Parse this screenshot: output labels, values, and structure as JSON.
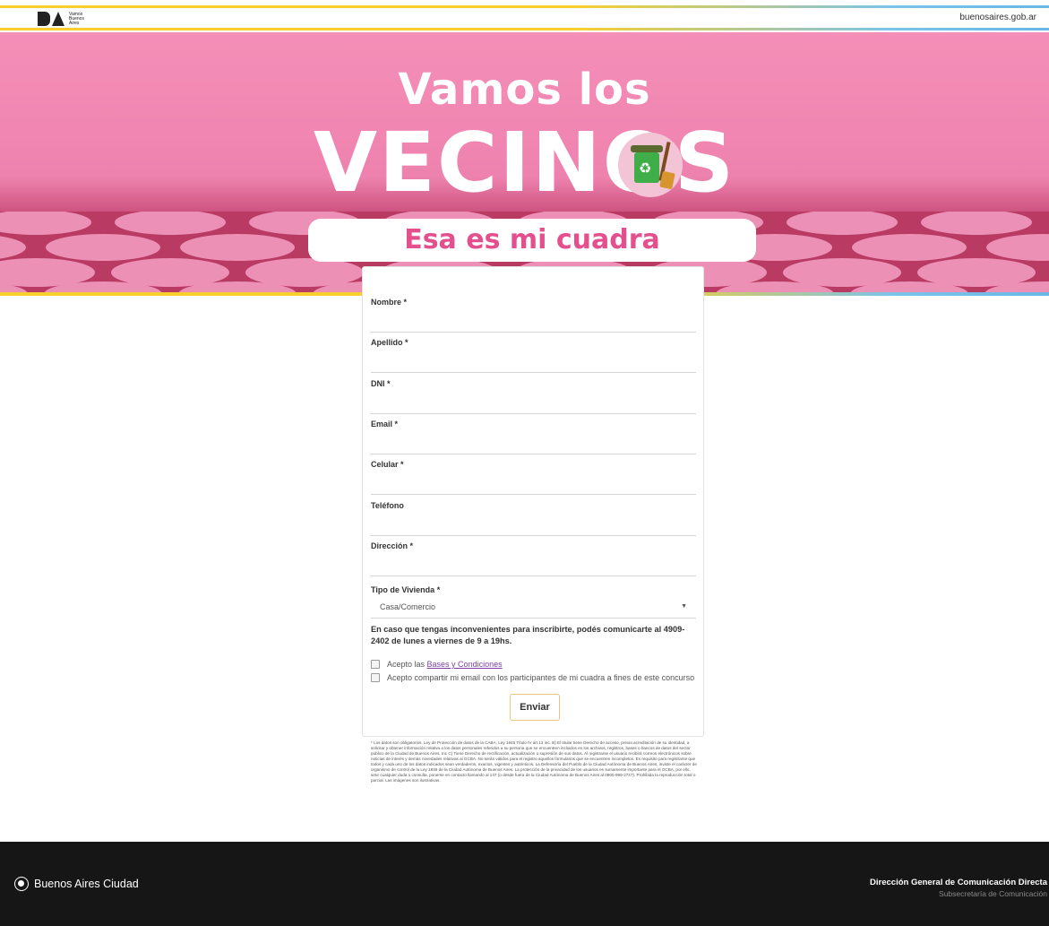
{
  "header": {
    "logo_text_line1": "Vamos",
    "logo_text_line2": "Buenos",
    "logo_text_line3": "Aires",
    "site_url": "buenosaires.gob.ar"
  },
  "hero": {
    "title_line1": "Vamos los",
    "title_line2": "VECINOS",
    "subtitle": "Esa es mi cuadra",
    "recycle_icon": "♻"
  },
  "form": {
    "fields": [
      {
        "label": "Nombre *",
        "value": ""
      },
      {
        "label": "Apellido *",
        "value": ""
      },
      {
        "label": "DNI *",
        "value": ""
      },
      {
        "label": "Email *",
        "value": ""
      },
      {
        "label": "Celular *",
        "value": ""
      },
      {
        "label": "Teléfono",
        "value": ""
      },
      {
        "label": "Dirección *",
        "value": ""
      }
    ],
    "housing": {
      "label": "Tipo de Vivienda *",
      "selected": "Casa/Comercio",
      "caret": "▼"
    },
    "notice": "En caso que tengas inconvenientes para inscribirte, podés comunicarte al 4909-2402 de lunes a viernes de 9 a 19hs.",
    "terms_prefix": "Acepto las ",
    "terms_link": "Bases y Condiciones",
    "share_email": "Acepto compartir mi email con los participantes de mi cuadra a fines de este concurso",
    "submit_label": "Enviar"
  },
  "legal": "* Los datos son obligatorios. Ley de Protección de datos de la CABA, Ley 1845 Título IV art.13 inc. B) El titular tiene Derecho de acceso, previa acreditación de su identidad, a solicitar y obtener información relativa a los datos personales referidos a su persona que se encuentren incluidos en los archivos, registros, bases o bancos de datos del sector público de la Ciudad de Buenos Aires. Inc C) Tiene Derecho de rectificación, actualización o supresión de sus datos. Al registrarse el usuario recibirá correos electrónicos sobre noticias de interés y demás novedades relativas al GCBA. No serán válidos para el registro aquellos formularios que se encuentren incompletos. Es requisito para registrarse que todos y cada uno de los datos indicados sean verdaderos, exactos, vigentes y auténticos. La Defensoría del Pueblo de la Ciudad Autónoma de Buenos Aires, inviste el carácter de organismo de control de la Ley 1845 de la Ciudad Autónoma de Buenos Aires. La protección de la privacidad de los usuarios es sumamente importante para el GCBA, por ello, ante cualquier duda o consulta, ponerse en contacto llamando al 147 (o desde fuera de la Ciudad Autónoma de Buenos Aires al 0800-999-2727). Prohibida la reproducción total o parcial. Las imágenes son ilustrativas.",
  "footer": {
    "brand": "Buenos Aires Ciudad",
    "direction": "Dirección General de Comunicación Directa",
    "subsecretaria": "Subsecretaría de Comunicación"
  },
  "colors": {
    "hero_pink": "#ee82ae",
    "subtitle_pink": "#e44f8e",
    "stripe_yellow": "#f7cf2f",
    "stripe_blue": "#6ab7e6",
    "footer_bg": "#161616"
  }
}
